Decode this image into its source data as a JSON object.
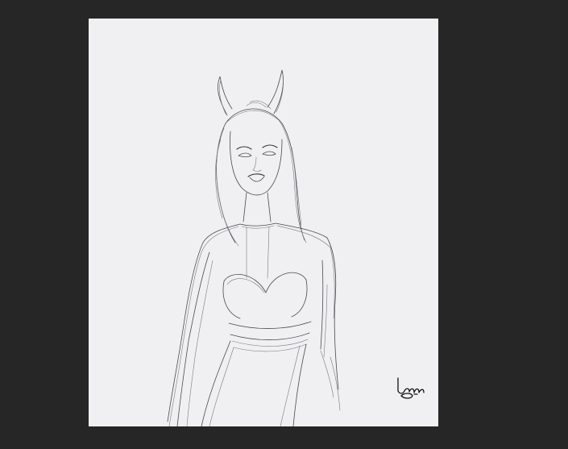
{
  "workspace": {
    "background_color": "#262626",
    "canvas_color": "#f0f0f2",
    "sketch_color": "#4a4a4e"
  },
  "artwork": {
    "subject_icon": "sketch-figure-with-horns",
    "signature_text": "lunadoh"
  }
}
